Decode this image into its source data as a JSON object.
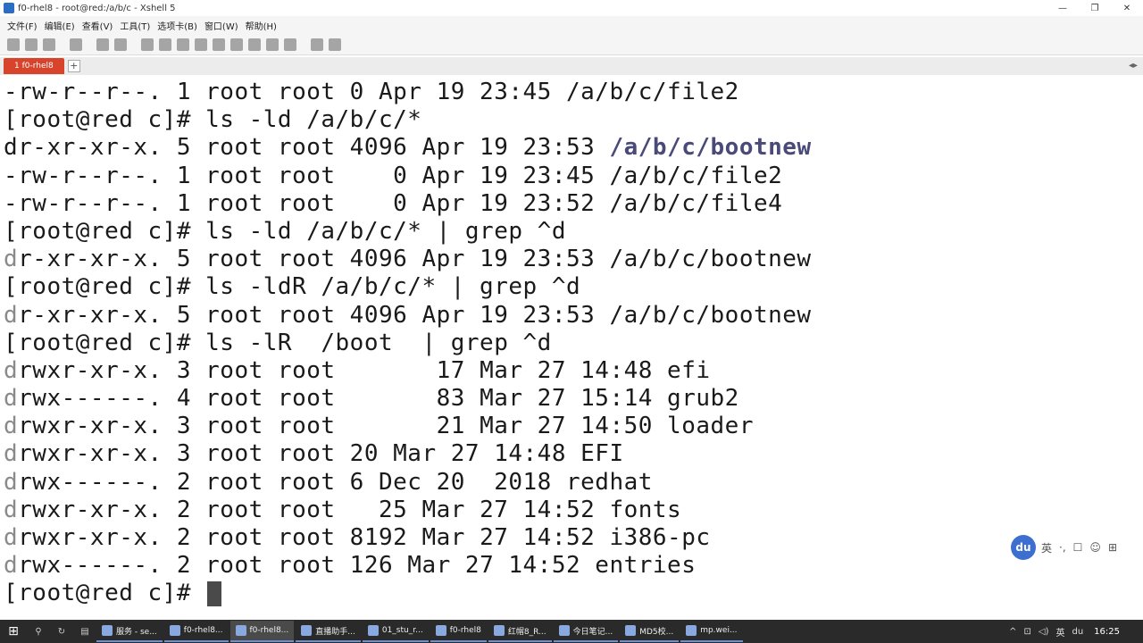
{
  "window": {
    "title": "f0-rhel8 - root@red:/a/b/c - Xshell 5",
    "controls": [
      "—",
      "❐",
      "✕"
    ]
  },
  "menubar": {
    "items": [
      "文件(F)",
      "编辑(E)",
      "查看(V)",
      "工具(T)",
      "选项卡(B)",
      "窗口(W)",
      "帮助(H)"
    ]
  },
  "tabs": {
    "active_label": "1 f0-rhel8",
    "add_label": "+",
    "menu_label": "◂▸"
  },
  "terminal": {
    "lines": [
      {
        "text": "-rw-r--r--. 1 root root 0 Apr 19 23:45 /a/b/c/file2"
      },
      {
        "text": "[root@red c]# ls -ld /a/b/c/*"
      },
      {
        "prefix": "dr-xr-xr-x. 5 root root 4096 Apr 19 23:53 ",
        "dir": "/a/b/c/bootnew"
      },
      {
        "text": "-rw-r--r--. 1 root root    0 Apr 19 23:45 /a/b/c/file2"
      },
      {
        "text": "-rw-r--r--. 1 root root    0 Apr 19 23:52 /a/b/c/file4"
      },
      {
        "text": "[root@red c]# ls -ld /a/b/c/* | grep ^d"
      },
      {
        "d": "d",
        "rest": "r-xr-xr-x. 5 root root 4096 Apr 19 23:53 /a/b/c/bootnew"
      },
      {
        "text": "[root@red c]# ls -ldR /a/b/c/* | grep ^d"
      },
      {
        "d": "d",
        "rest": "r-xr-xr-x. 5 root root 4096 Apr 19 23:53 /a/b/c/bootnew"
      },
      {
        "text": "[root@red c]# ls -lR  /boot  | grep ^d"
      },
      {
        "d": "d",
        "rest": "rwxr-xr-x. 3 root root       17 Mar 27 14:48 efi"
      },
      {
        "d": "d",
        "rest": "rwx------. 4 root root       83 Mar 27 15:14 grub2"
      },
      {
        "d": "d",
        "rest": "rwxr-xr-x. 3 root root       21 Mar 27 14:50 loader"
      },
      {
        "d": "d",
        "rest": "rwxr-xr-x. 3 root root 20 Mar 27 14:48 EFI"
      },
      {
        "d": "d",
        "rest": "rwx------. 2 root root 6 Dec 20  2018 redhat"
      },
      {
        "d": "d",
        "rest": "rwxr-xr-x. 2 root root   25 Mar 27 14:52 fonts"
      },
      {
        "d": "d",
        "rest": "rwxr-xr-x. 2 root root 8192 Mar 27 14:52 i386-pc"
      },
      {
        "d": "d",
        "rest": "rwx------. 2 root root 126 Mar 27 14:52 entries"
      }
    ],
    "prompt": "[root@red c]# "
  },
  "ime": {
    "logo": "du",
    "items": [
      "英",
      "·,",
      "☐",
      "☺",
      "⊞"
    ]
  },
  "taskbar": {
    "start": "⊞",
    "tasks": [
      {
        "label": "服务 - se..."
      },
      {
        "label": "f0-rhel8..."
      },
      {
        "label": "f0-rhel8...",
        "active": true
      },
      {
        "label": "直播助手..."
      },
      {
        "label": "01_stu_r..."
      },
      {
        "label": "f0-rhel8"
      },
      {
        "label": "红帽8_R..."
      },
      {
        "label": "今日笔记..."
      },
      {
        "label": "MD5校..."
      },
      {
        "label": "mp.wei..."
      }
    ],
    "tray": [
      "^",
      "⊡",
      "◁)",
      "英",
      "du"
    ],
    "clock": "16:25"
  }
}
